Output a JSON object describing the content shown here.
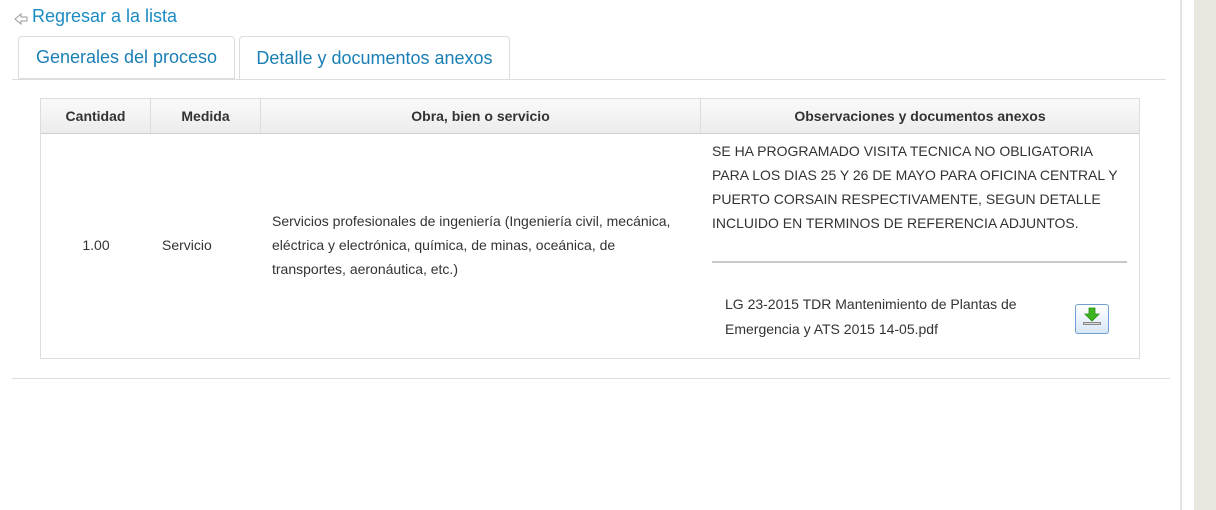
{
  "back_link": {
    "label": "Regresar a la lista",
    "icon": "left-arrow-icon"
  },
  "tabs": [
    {
      "label": "Generales del proceso",
      "active": false
    },
    {
      "label": "Detalle y documentos anexos",
      "active": true
    }
  ],
  "table": {
    "headers": [
      "Cantidad",
      "Medida",
      "Obra, bien o servicio",
      "Observaciones y documentos anexos"
    ],
    "rows": [
      {
        "cantidad": "1.00",
        "medida": "Servicio",
        "obra": "Servicios profesionales de ingeniería (Ingeniería civil, mecánica, eléctrica y electrónica, química, de minas, oceánica, de transportes, aeronáutica, etc.)",
        "observaciones": "SE HA PROGRAMADO VISITA TECNICA NO OBLIGATORIA PARA LOS DIAS 25 Y 26 DE MAYO PARA OFICINA CENTRAL Y PUERTO CORSAIN RESPECTIVAMENTE, SEGUN DETALLE INCLUIDO EN TERMINOS DE REFERENCIA ADJUNTOS.",
        "attachment": {
          "file_name": "LG 23-2015 TDR Mantenimiento de Plantas de Emergencia y ATS 2015 14-05.pdf",
          "icon": "download-icon"
        }
      }
    ]
  },
  "colors": {
    "link": "#1a8bc3",
    "tab_text": "#1a7fb5",
    "download_arrow": "#3cb521"
  }
}
